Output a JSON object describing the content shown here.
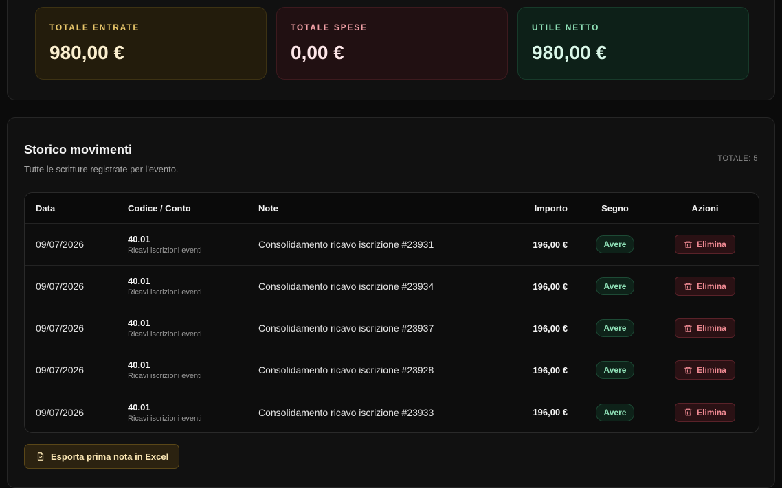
{
  "summary": {
    "income": {
      "label": "TOTALE ENTRATE",
      "value": "980,00 €"
    },
    "expense": {
      "label": "TOTALE SPESE",
      "value": "0,00 €"
    },
    "net": {
      "label": "UTILE NETTO",
      "value": "980,00 €"
    }
  },
  "history": {
    "title": "Storico movimenti",
    "subtitle": "Tutte le scritture registrate per l'evento.",
    "total_label": "TOTALE: 5",
    "columns": {
      "date": "Data",
      "code": "Codice / Conto",
      "note": "Note",
      "amount": "Importo",
      "sign": "Segno",
      "actions": "Azioni"
    },
    "rows": [
      {
        "date": "09/07/2026",
        "code": "40.01",
        "account": "Ricavi iscrizioni eventi",
        "note": "Consolidamento ricavo iscrizione #23931",
        "amount": "196,00 €",
        "sign": "Avere",
        "action": "Elimina"
      },
      {
        "date": "09/07/2026",
        "code": "40.01",
        "account": "Ricavi iscrizioni eventi",
        "note": "Consolidamento ricavo iscrizione #23934",
        "amount": "196,00 €",
        "sign": "Avere",
        "action": "Elimina"
      },
      {
        "date": "09/07/2026",
        "code": "40.01",
        "account": "Ricavi iscrizioni eventi",
        "note": "Consolidamento ricavo iscrizione #23937",
        "amount": "196,00 €",
        "sign": "Avere",
        "action": "Elimina"
      },
      {
        "date": "09/07/2026",
        "code": "40.01",
        "account": "Ricavi iscrizioni eventi",
        "note": "Consolidamento ricavo iscrizione #23928",
        "amount": "196,00 €",
        "sign": "Avere",
        "action": "Elimina"
      },
      {
        "date": "09/07/2026",
        "code": "40.01",
        "account": "Ricavi iscrizioni eventi",
        "note": "Consolidamento ricavo iscrizione #23933",
        "amount": "196,00 €",
        "sign": "Avere",
        "action": "Elimina"
      }
    ],
    "export_label": "Esporta prima nota in Excel"
  },
  "icons": {
    "delete": "trash-icon",
    "export": "file-export-icon"
  },
  "colors": {
    "income_accent": "#e9c76b",
    "expense_accent": "#f1a0a6",
    "net_accent": "#8fe0b7",
    "delete_accent": "#f08a93"
  }
}
